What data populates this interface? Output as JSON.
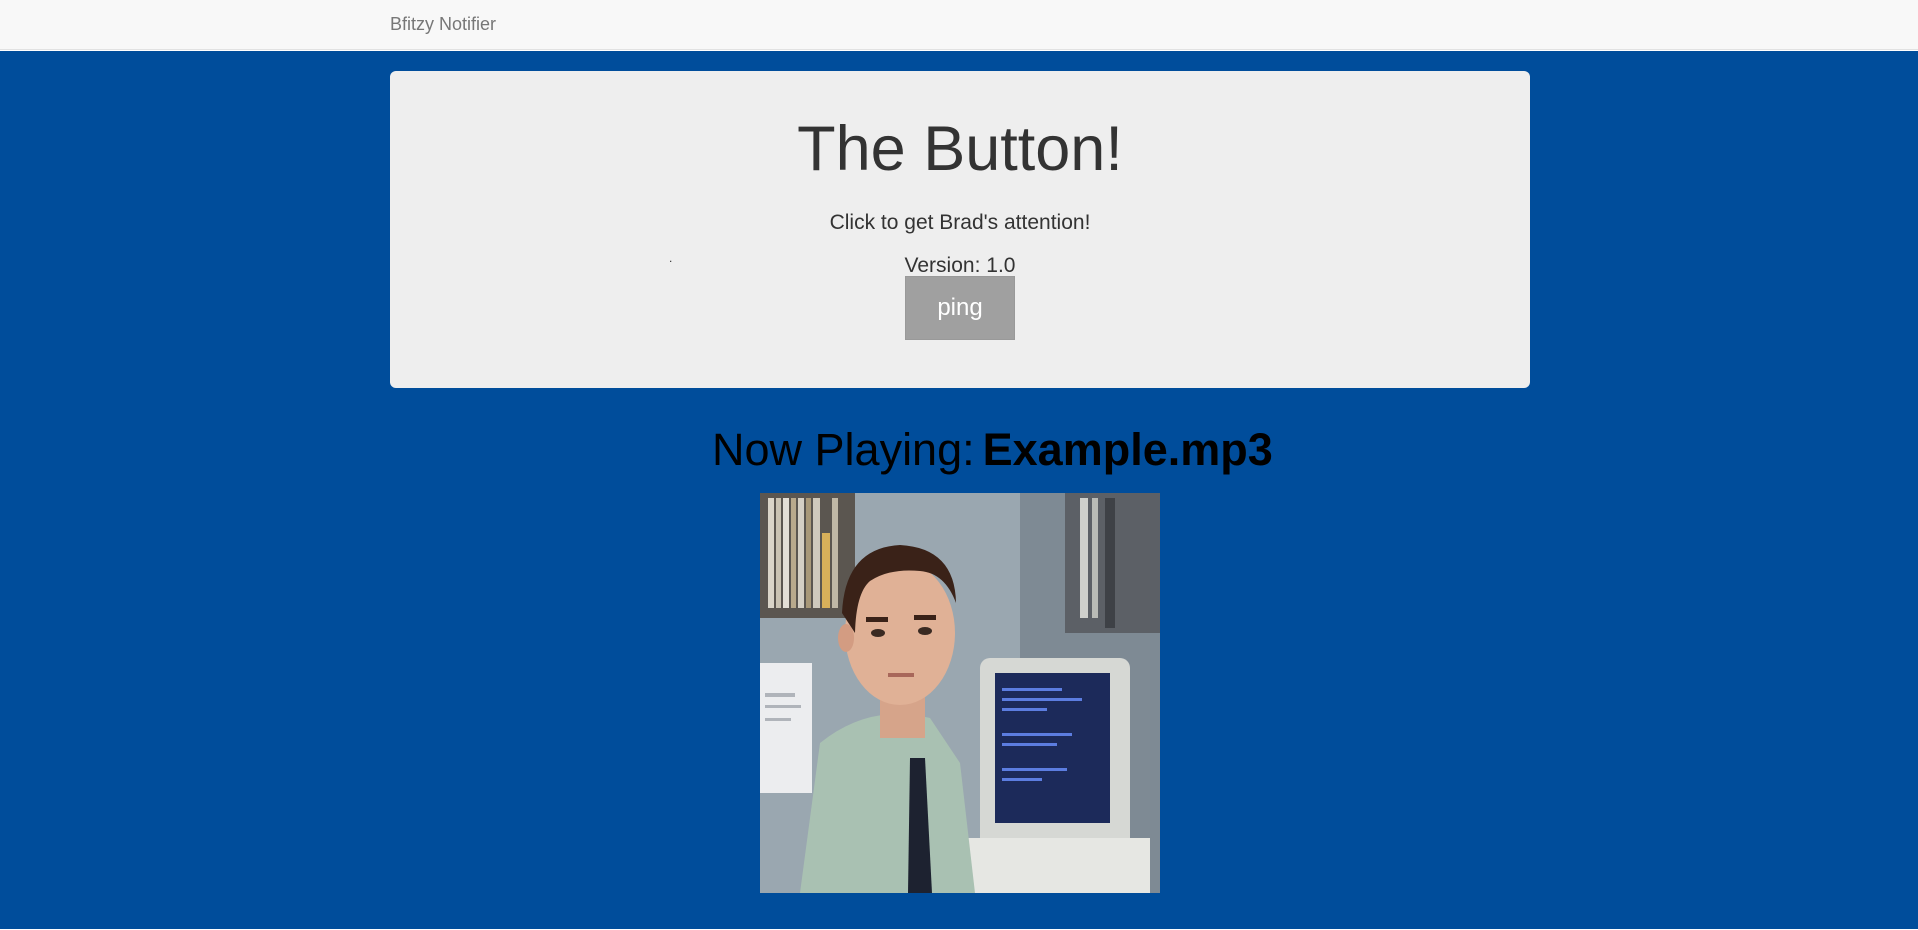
{
  "navbar": {
    "brand": "Bfitzy Notifier"
  },
  "jumbotron": {
    "title": "The Button!",
    "subtitle": "Click to get Brad's attention!",
    "stray_mark": ".",
    "version_label": "Version:",
    "version_value": "1.0",
    "button_label": "ping"
  },
  "now_playing": {
    "label": "Now Playing:",
    "file": "Example.mp3"
  },
  "media": {
    "icon": "office-worker-gif-image"
  },
  "colors": {
    "page_background": "#004d9b",
    "navbar_background": "#f8f8f8",
    "jumbotron_background": "#eeeeee",
    "button_background": "#a0a0a0"
  }
}
